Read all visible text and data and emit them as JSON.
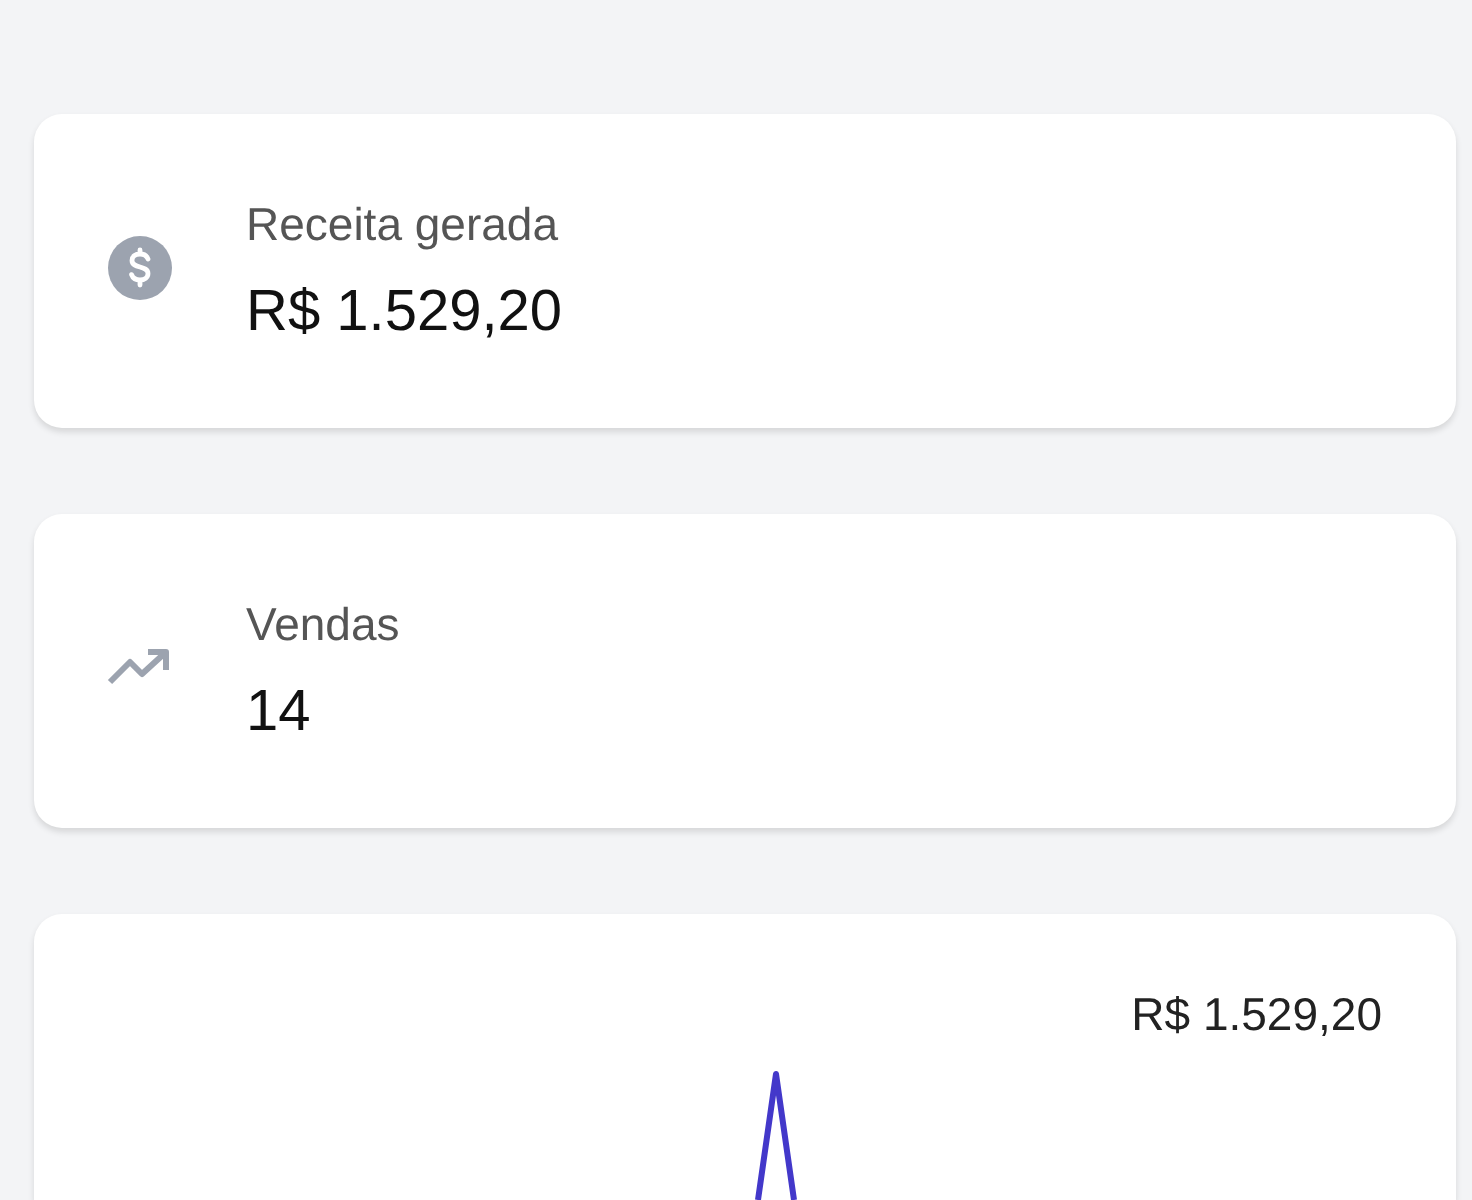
{
  "cards": [
    {
      "kind": "revenue",
      "label": "Receita gerada",
      "value": "R$ 1.529,20"
    },
    {
      "kind": "sales",
      "label": "Vendas",
      "value": "14"
    }
  ],
  "chart": {
    "value_label": "R$ 1.529,20"
  }
}
